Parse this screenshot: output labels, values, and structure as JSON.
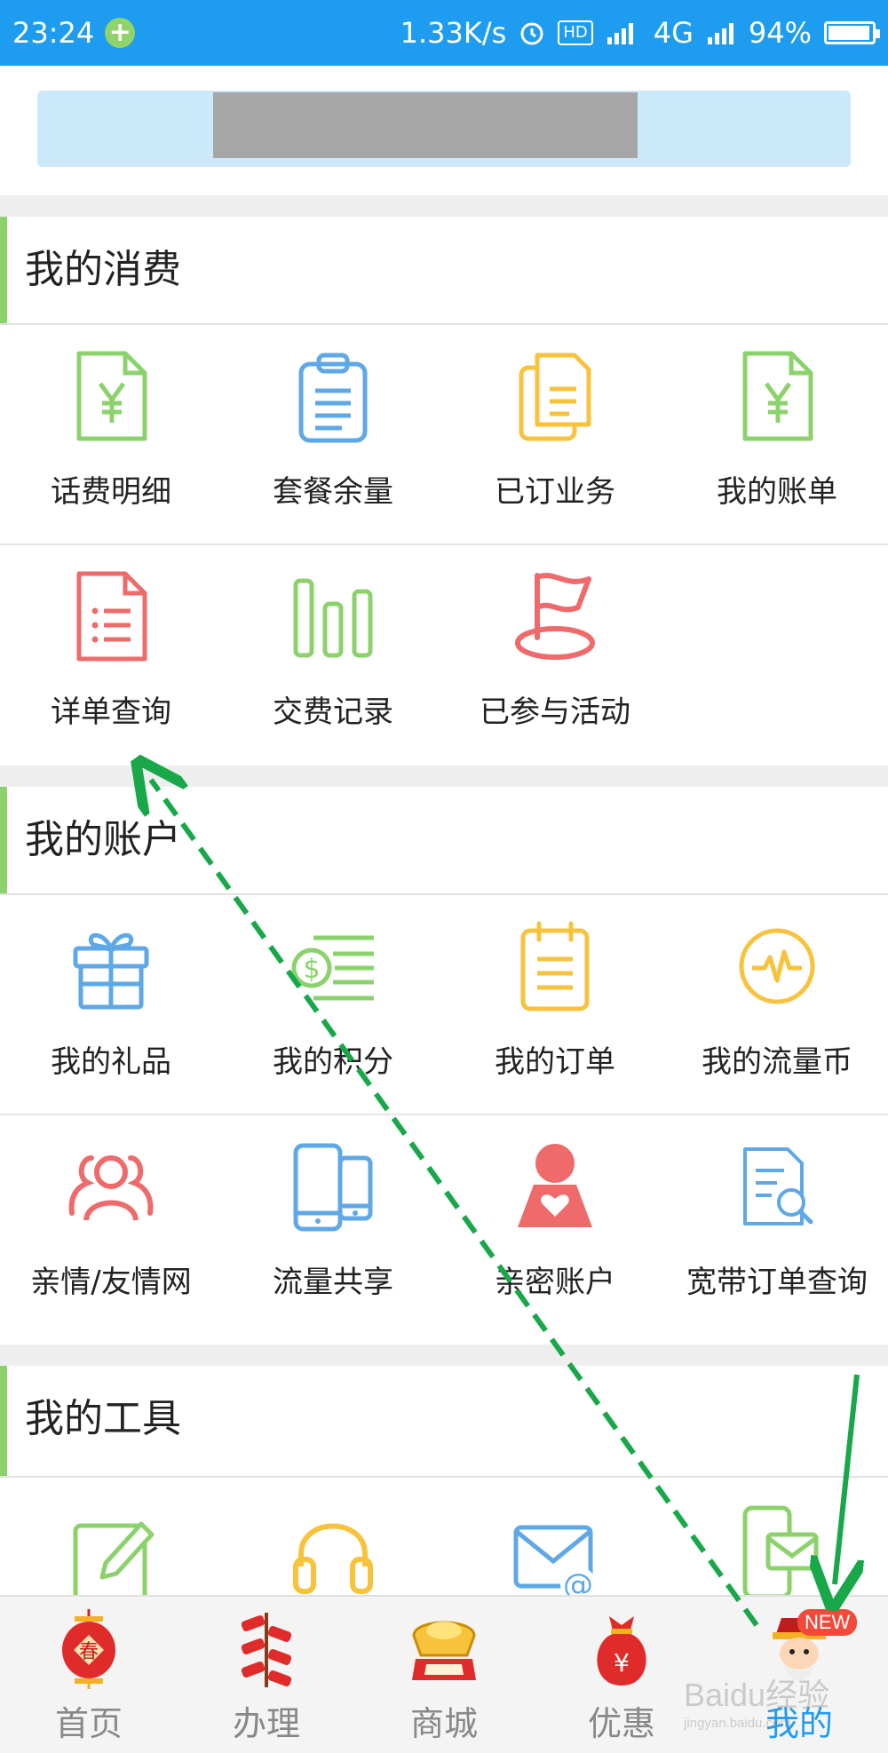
{
  "status_bar": {
    "time": "23:24",
    "network_speed": "1.33K/s",
    "hd_badge": "HD",
    "network_type": "4G",
    "battery": "94%",
    "icons": [
      "plus-notification-icon",
      "alarm-icon",
      "signal-icon",
      "battery-icon"
    ]
  },
  "sections": {
    "consumption": {
      "title": "我的消费",
      "items": [
        {
          "label": "话费明细",
          "icon": "yuan-document-icon",
          "color": "#8cd26c"
        },
        {
          "label": "套餐余量",
          "icon": "clipboard-icon",
          "color": "#5ea8e8"
        },
        {
          "label": "已订业务",
          "icon": "documents-icon",
          "color": "#f7c23c"
        },
        {
          "label": "我的账单",
          "icon": "yuan-document-icon",
          "color": "#8cd26c"
        },
        {
          "label": "详单查询",
          "icon": "list-document-icon",
          "color": "#ef6a6a"
        },
        {
          "label": "交费记录",
          "icon": "bar-chart-icon",
          "color": "#8cd26c"
        },
        {
          "label": "已参与活动",
          "icon": "flag-icon",
          "color": "#ef6a6a"
        }
      ]
    },
    "account": {
      "title": "我的账户",
      "items": [
        {
          "label": "我的礼品",
          "icon": "gift-icon",
          "color": "#5ea8e8"
        },
        {
          "label": "我的积分",
          "icon": "dollar-list-icon",
          "color": "#8cd26c"
        },
        {
          "label": "我的订单",
          "icon": "calendar-list-icon",
          "color": "#f7c23c"
        },
        {
          "label": "我的流量币",
          "icon": "pulse-coin-icon",
          "color": "#f7c23c"
        },
        {
          "label": "亲情/友情网",
          "icon": "people-icon",
          "color": "#ef6a6a"
        },
        {
          "label": "流量共享",
          "icon": "phones-icon",
          "color": "#5ea8e8"
        },
        {
          "label": "亲密账户",
          "icon": "heart-person-icon",
          "color": "#ef6a6a"
        },
        {
          "label": "宽带订单查询",
          "icon": "search-document-icon",
          "color": "#5ea8e8"
        }
      ]
    },
    "tools": {
      "title": "我的工具",
      "items": [
        {
          "icon": "edit-icon",
          "color": "#8cd26c"
        },
        {
          "icon": "headphones-icon",
          "color": "#f7c23c"
        },
        {
          "icon": "email-icon",
          "color": "#5ea8e8"
        },
        {
          "icon": "phone-message-icon",
          "color": "#8cd26c"
        }
      ]
    }
  },
  "bottom_nav": {
    "items": [
      {
        "label": "首页",
        "icon": "lantern-icon"
      },
      {
        "label": "办理",
        "icon": "firecracker-icon"
      },
      {
        "label": "商城",
        "icon": "gold-ingot-icon"
      },
      {
        "label": "优惠",
        "icon": "money-bag-icon"
      },
      {
        "label": "我的",
        "icon": "fortune-god-icon",
        "badge": "NEW",
        "active": true
      }
    ]
  },
  "watermark": {
    "text": "Baidu经验",
    "url": "jingyan.baidu.com"
  },
  "colors": {
    "accent": "#1e9cf0",
    "green": "#8cd26c",
    "arrow": "#18a84a"
  }
}
